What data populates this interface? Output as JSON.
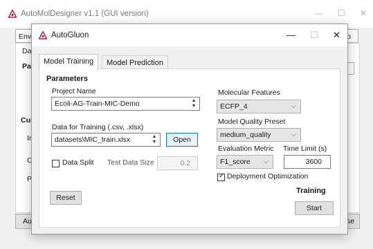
{
  "main_window": {
    "title": "AutoMolDesigner v1.1 (GUI version)",
    "controls": {
      "minimize": "—",
      "maximize": "☐",
      "close": "✕"
    },
    "tab_partial": "Envi",
    "right_button_partial": "p",
    "panel_tab_partial": "Dat",
    "section_partial": "Par",
    "labels_partial": [
      "Cur",
      "In",
      "O",
      "Pr"
    ],
    "bottom_buttons_partial": [
      "Aut",
      "se"
    ]
  },
  "dialog": {
    "title": "AutoGluon",
    "controls": {
      "minimize": "—",
      "maximize": "☐",
      "close": "✕"
    },
    "tabs": [
      {
        "label": "Model Training",
        "active": true
      },
      {
        "label": "Model Prediction",
        "active": false
      }
    ],
    "section_title": "Parameters",
    "project_name": {
      "label": "Project Name",
      "value": "Ecoli-AG-Train-MIC-Demo"
    },
    "training_data": {
      "label": "Data for Training (.csv, .xlsx)",
      "value": "datasets\\MIC_train.xlsx",
      "open_button": "Open"
    },
    "data_split": {
      "label": "Data Split",
      "checked": false,
      "test_size_label": "Test Data Size",
      "test_size_value": "0.2"
    },
    "reset_button": "Reset",
    "molecular_features": {
      "label": "Molecular Features",
      "value": "ECFP_4"
    },
    "quality_preset": {
      "label": "Model Quality Preset",
      "value": "medium_quality"
    },
    "evaluation_metric": {
      "label": "Evaluation Metric",
      "value": "F1_score"
    },
    "time_limit": {
      "label": "Time Limit (s)",
      "value": "3600"
    },
    "deployment": {
      "label": "Deployment Optimization",
      "checked": true,
      "check_glyph": "✓"
    },
    "training_section": "Training",
    "start_button": "Start",
    "spin_up": "▲",
    "spin_down": "▼",
    "chevron": "⌵"
  }
}
